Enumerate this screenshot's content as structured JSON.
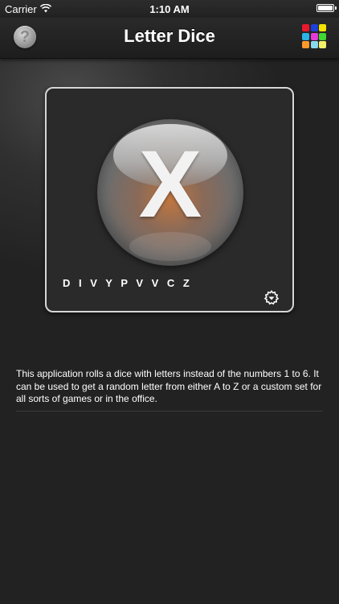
{
  "status_bar": {
    "carrier": "Carrier",
    "time": "1:10 AM"
  },
  "nav": {
    "title": "Letter Dice",
    "help_label": "?"
  },
  "palette": {
    "colors": [
      "#e8192c",
      "#1e3fd8",
      "#f4e400",
      "#2ab3e6",
      "#e43bd8",
      "#3fd832",
      "#ff9a2a",
      "#8ad7f0",
      "#f4f06a"
    ]
  },
  "dice": {
    "current_letter": "X",
    "letter_set": "D I V Y P V V C Z"
  },
  "description": {
    "text": "This application rolls a dice with letters instead of the numbers 1 to 6. It can be used to get a random letter from either A to Z or a custom set for all sorts of games or in the office."
  }
}
